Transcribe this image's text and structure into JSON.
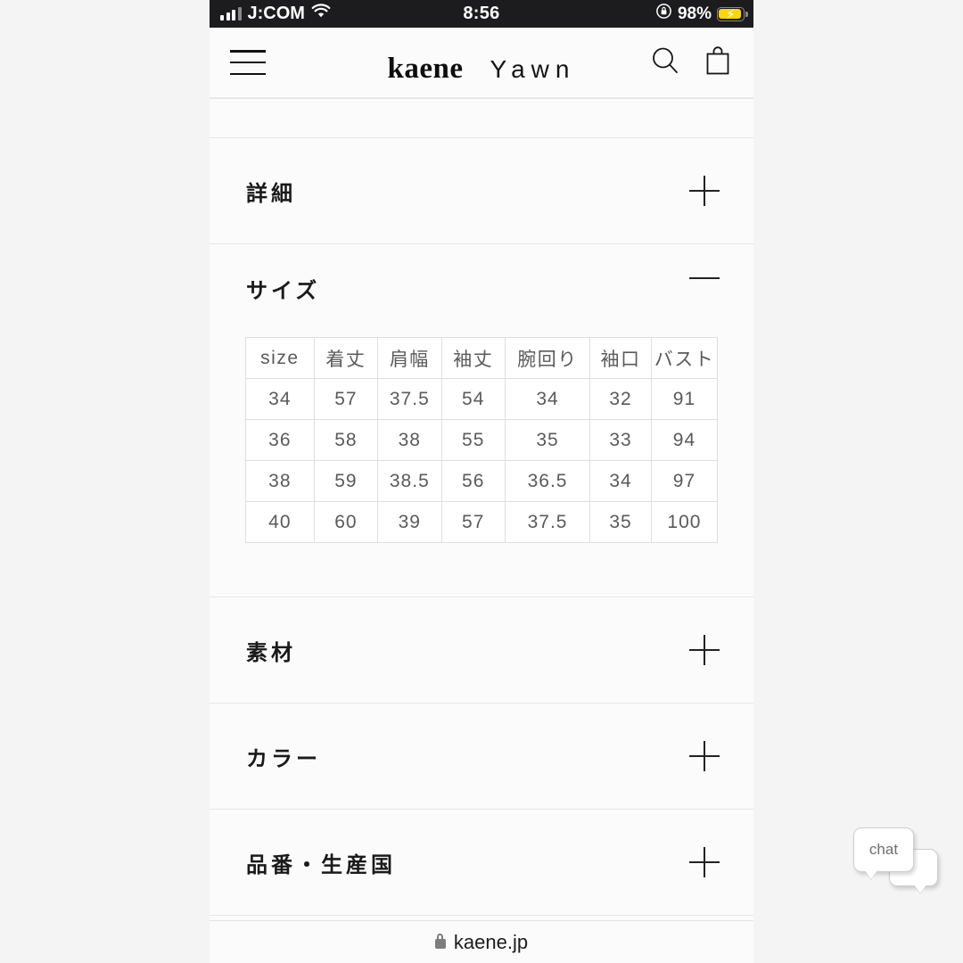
{
  "statusbar": {
    "carrier": "J:COM",
    "time": "8:56",
    "battery_pct": "98%",
    "signal_icon": "cellular-bars-icon",
    "wifi_icon": "wifi-icon",
    "rotation_lock_icon": "rotation-lock-icon",
    "battery_icon": "battery-charging-icon",
    "battery_color": "#ffd60a"
  },
  "header": {
    "menu_icon": "hamburger-menu-icon",
    "brand_primary": "kaene",
    "brand_secondary": "Yawn",
    "search_icon": "search-icon",
    "bag_icon": "shopping-bag-icon"
  },
  "accordions": [
    {
      "label": "詳細",
      "state": "collapsed",
      "toggle": "plus-icon"
    },
    {
      "label": "サイズ",
      "state": "expanded",
      "toggle": "minus-icon"
    },
    {
      "label": "素材",
      "state": "collapsed",
      "toggle": "plus-icon"
    },
    {
      "label": "カラー",
      "state": "collapsed",
      "toggle": "plus-icon"
    },
    {
      "label": "品番・生産国",
      "state": "collapsed",
      "toggle": "plus-icon"
    }
  ],
  "size_table": {
    "headers": [
      "size",
      "着丈",
      "肩幅",
      "袖丈",
      "腕回り",
      "袖口",
      "バスト"
    ],
    "rows": [
      [
        "34",
        "57",
        "37.5",
        "54",
        "34",
        "32",
        "91"
      ],
      [
        "36",
        "58",
        "38",
        "55",
        "35",
        "33",
        "94"
      ],
      [
        "38",
        "59",
        "38.5",
        "56",
        "36.5",
        "34",
        "97"
      ],
      [
        "40",
        "60",
        "39",
        "57",
        "37.5",
        "35",
        "100"
      ]
    ]
  },
  "chat_widget": {
    "label": "chat",
    "icon": "chat-bubbles-icon"
  },
  "browser": {
    "url": "kaene.jp",
    "lock_icon": "lock-icon"
  }
}
